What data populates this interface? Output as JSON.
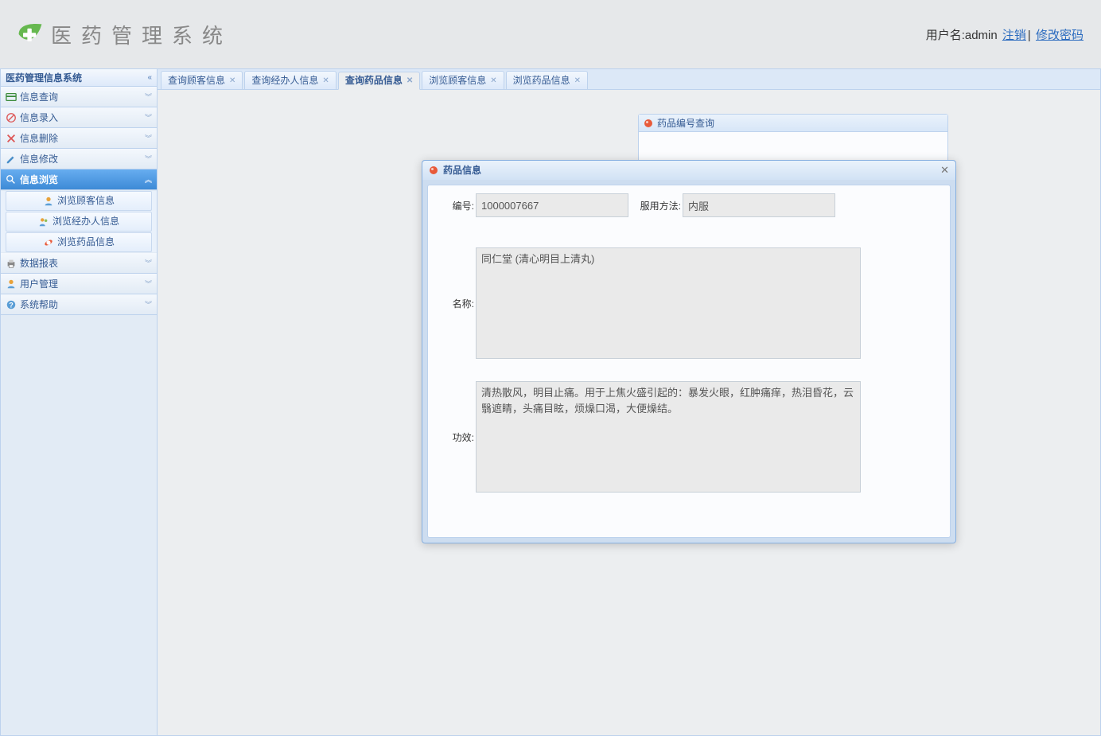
{
  "header": {
    "app_title": "医药管理系统",
    "user_label_prefix": "用户名:",
    "username": "admin",
    "logout_label": "注销",
    "change_pw_label": "修改密码",
    "separator": "| "
  },
  "sidebar": {
    "title": "医药管理信息系统",
    "groups": [
      {
        "label": "信息查询",
        "expanded": false
      },
      {
        "label": "信息录入",
        "expanded": false
      },
      {
        "label": "信息删除",
        "expanded": false
      },
      {
        "label": "信息修改",
        "expanded": false
      },
      {
        "label": "信息浏览",
        "expanded": true,
        "items": [
          {
            "label": "浏览顾客信息"
          },
          {
            "label": "浏览经办人信息"
          },
          {
            "label": "浏览药品信息"
          }
        ]
      },
      {
        "label": "数据报表",
        "expanded": false
      },
      {
        "label": "用户管理",
        "expanded": false
      },
      {
        "label": "系统帮助",
        "expanded": false
      }
    ]
  },
  "tabs": {
    "items": [
      {
        "label": "查询顾客信息",
        "active": false
      },
      {
        "label": "查询经办人信息",
        "active": false
      },
      {
        "label": "查询药品信息",
        "active": true
      },
      {
        "label": "浏览顾客信息",
        "active": false
      },
      {
        "label": "浏览药品信息",
        "active": false
      }
    ]
  },
  "back_panel": {
    "title": "药品编号查询"
  },
  "dialog": {
    "title": "药品信息",
    "fields": {
      "id_label": "编号:",
      "id_value": "1000007667",
      "usage_label": "服用方法:",
      "usage_value": "内服",
      "name_label": "名称:",
      "name_value": "同仁堂 (清心明目上清丸)",
      "effect_label": "功效:",
      "effect_value": "清热散风，明目止痛。用于上焦火盛引起的：暴发火眼，红肿痛痒，热泪昏花，云翳遮睛，头痛目眩，烦燥口渴，大便燥结。"
    }
  }
}
